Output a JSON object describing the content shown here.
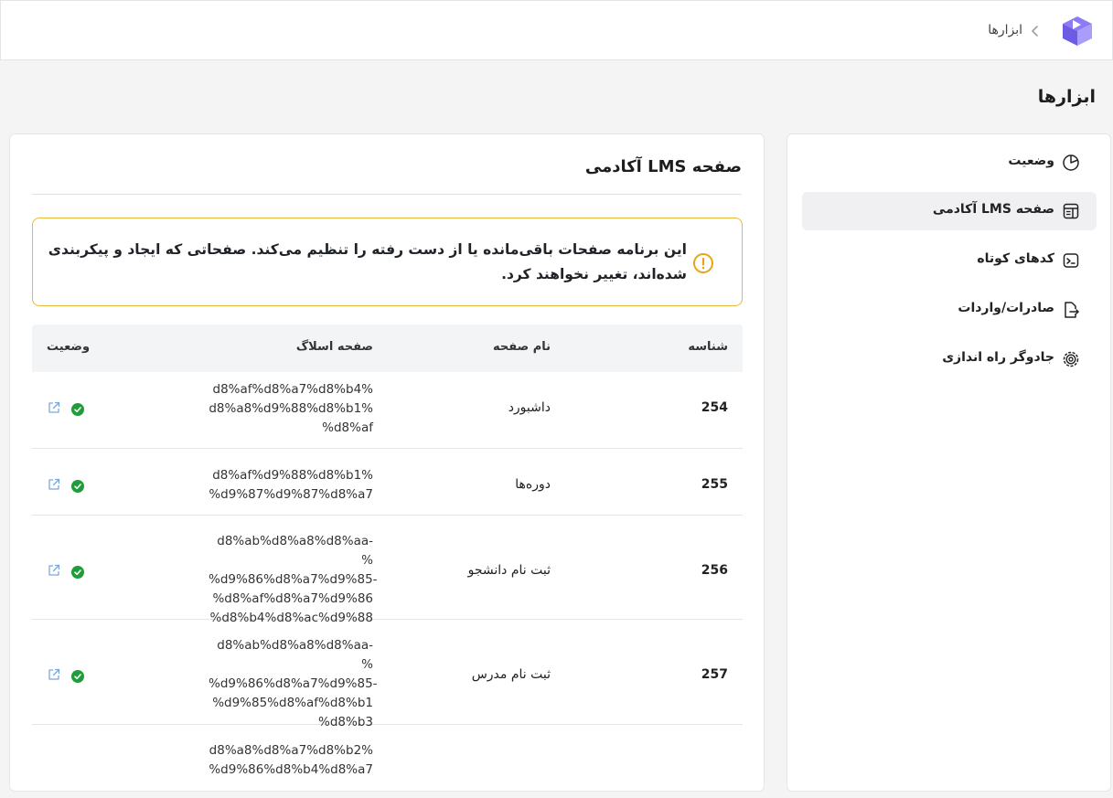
{
  "header": {
    "breadcrumb": "ابزارها",
    "logo_icon": "academy-logo-icon",
    "separator_icon": "chevron-left-icon"
  },
  "page_title": "ابزارها",
  "sidebar": {
    "items": [
      {
        "label": "وضعیت",
        "icon": "pie-chart-icon",
        "active": false
      },
      {
        "label": "آکادمی LMS صفحه",
        "icon": "layout-icon",
        "active": true
      },
      {
        "label": "کدهای کوتاه",
        "icon": "terminal-icon",
        "active": false
      },
      {
        "label": "صادرات/واردات",
        "icon": "file-export-icon",
        "active": false
      },
      {
        "label": "جادوگر راه اندازی",
        "icon": "gear-icon",
        "active": false
      }
    ]
  },
  "main": {
    "title": "آکادمی LMS صفحه",
    "notice": "این برنامه صفحات باقی‌مانده یا از دست رفته را تنظیم می‌کند. صفحاتی که ایجاد و پیکربندی شده‌اند، تغییر نخواهند کرد.",
    "table": {
      "headers": {
        "id": "شناسه",
        "name": "نام صفحه",
        "slug": "صفحه اسلاگ",
        "status": "وضعیت"
      },
      "rows": [
        {
          "id": "254",
          "name": "داشبورد",
          "slug": [
            "d8%af%d8%a7%d8%b4%",
            "d8%a8%d9%88%d8%b1%",
            "%d8%af"
          ],
          "status": "ok"
        },
        {
          "id": "255",
          "name": "دوره‌ها",
          "slug": [
            "d8%af%d9%88%d8%b1%",
            "%d9%87%d9%87%d8%a7"
          ],
          "status": "ok"
        },
        {
          "id": "256",
          "name": "ثبت نام دانشجو",
          "slug": [
            "d8%ab%d8%a8%d8%aa-%",
            "%d9%86%d8%a7%d9%85-",
            "%d8%af%d8%a7%d9%86",
            "%d8%b4%d8%ac%d9%88"
          ],
          "status": "ok"
        },
        {
          "id": "257",
          "name": "ثبت نام مدرس",
          "slug": [
            "d8%ab%d8%a8%d8%aa-%",
            "%d9%86%d8%a7%d9%85-",
            "%d9%85%d8%af%d8%b1",
            "%d8%b3"
          ],
          "status": "ok"
        },
        {
          "id": "",
          "name": "",
          "slug": [
            "d8%a8%d8%a7%d8%b2%",
            "%d9%86%d8%b4%d8%a7"
          ],
          "status": ""
        }
      ]
    }
  },
  "colors": {
    "notice_border": "#e8b73d",
    "notice_icon": "#e8a317",
    "status_ok": "#1f9d3a",
    "external_link": "#7aa7d9",
    "active_bg": "#f0f0f2"
  }
}
